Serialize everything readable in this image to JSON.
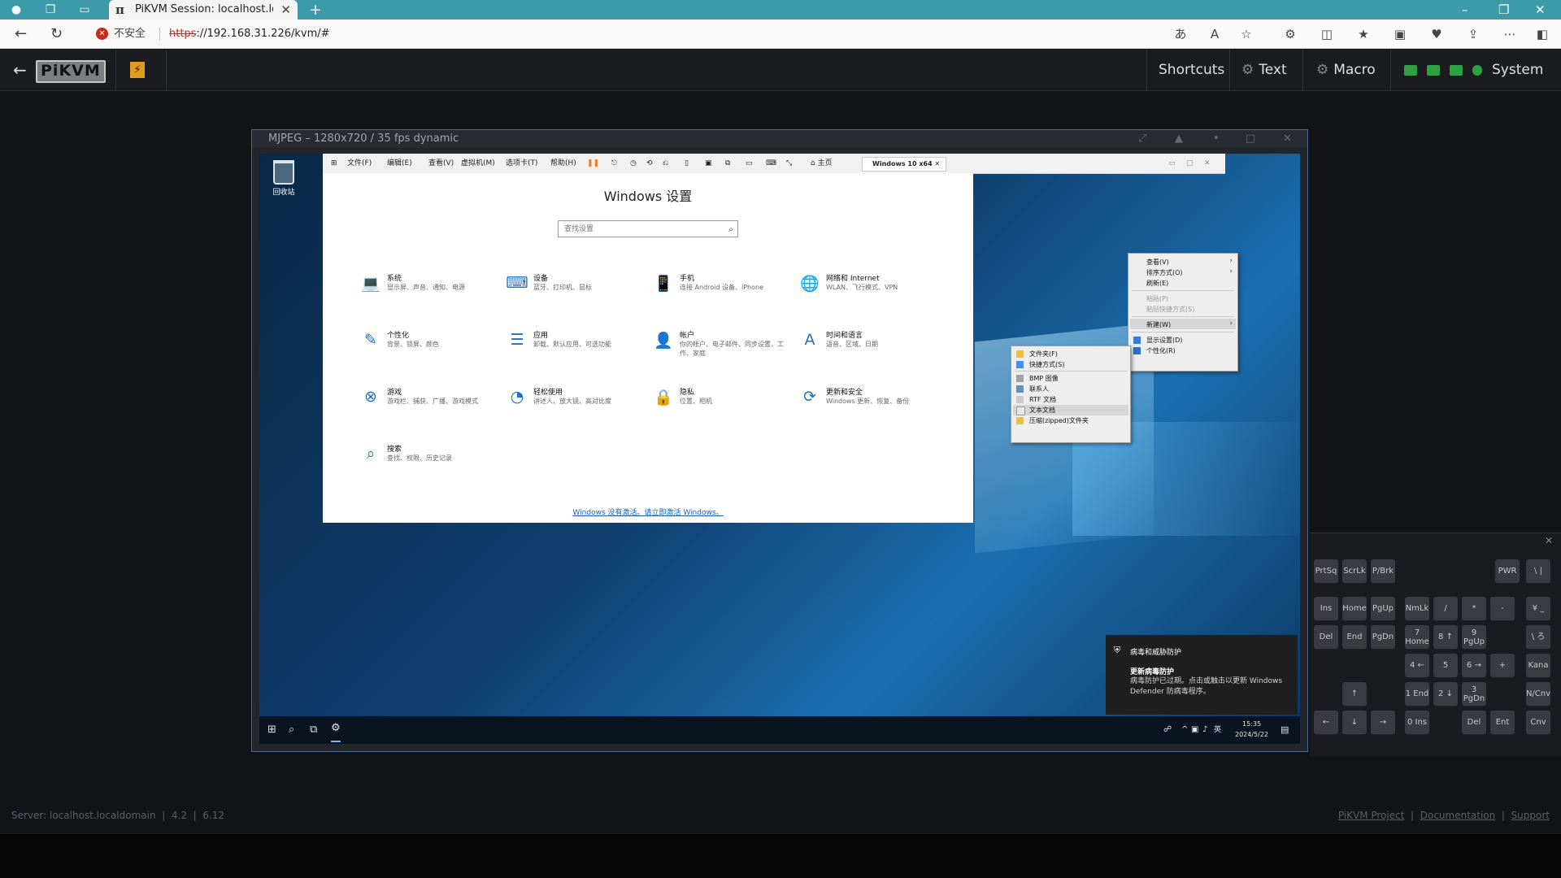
{
  "browser": {
    "tab_title": "PiKVM Session: localhost.localdo",
    "new_tab": "+",
    "security_label": "不安全",
    "url_scheme": "https",
    "url_rest": "://192.168.31.226/kvm/#"
  },
  "kvm_nav": {
    "logo": "PiKVM",
    "menus": [
      "Shortcuts",
      "Text",
      "Macro",
      "System"
    ],
    "led_colors": [
      "#2ea043",
      "#2ea043",
      "#2ea043",
      "#2ea043"
    ]
  },
  "stream": {
    "title": "MJPEG – 1280x720 / 35 fps dynamic"
  },
  "vm": {
    "recycle_bin": "回收站",
    "toolbar_menus": [
      "文件(F)",
      "编辑(E)",
      "查看(V)",
      "虚拟机(M)",
      "选项卡(T)",
      "帮助(H)"
    ],
    "tabs": [
      "主页",
      "Windows 10 x64"
    ],
    "settings": {
      "title": "Windows 设置",
      "search_placeholder": "查找设置",
      "items": [
        {
          "name": "系统",
          "desc": "显示屏、声音、通知、电源",
          "icon": "💻"
        },
        {
          "name": "设备",
          "desc": "蓝牙、打印机、鼠标",
          "icon": "⌨"
        },
        {
          "name": "手机",
          "desc": "连接 Android 设备、iPhone",
          "icon": "📱"
        },
        {
          "name": "网络和 Internet",
          "desc": "WLAN、飞行模式、VPN",
          "icon": "🌐"
        },
        {
          "name": "个性化",
          "desc": "背景、锁屏、颜色",
          "icon": "✎"
        },
        {
          "name": "应用",
          "desc": "卸载、默认应用、可选功能",
          "icon": "☰"
        },
        {
          "name": "帐户",
          "desc": "你的帐户、电子邮件、同步设置、工作、家庭",
          "icon": "👤"
        },
        {
          "name": "时间和语言",
          "desc": "语音、区域、日期",
          "icon": "A"
        },
        {
          "name": "游戏",
          "desc": "游戏栏、捕获、广播、游戏模式",
          "icon": "⊗"
        },
        {
          "name": "轻松使用",
          "desc": "讲述人、放大镜、高对比度",
          "icon": "◔"
        },
        {
          "name": "隐私",
          "desc": "位置、相机",
          "icon": "🔒"
        },
        {
          "name": "更新和安全",
          "desc": "Windows 更新、恢复、备份",
          "icon": "⟳"
        },
        {
          "name": "搜索",
          "desc": "查找、权限、历史记录",
          "icon": "⌕"
        }
      ],
      "activation_link": "Windows 没有激活。请立即激活 Windows。"
    },
    "context_menu": {
      "items": [
        {
          "label": "查看(V)",
          "arrow": true,
          "disabled": false
        },
        {
          "label": "排序方式(O)",
          "arrow": true,
          "disabled": false
        },
        {
          "label": "刷新(E)",
          "arrow": false,
          "disabled": false
        },
        {
          "label": "粘贴(P)",
          "arrow": false,
          "disabled": true
        },
        {
          "label": "粘贴快捷方式(S)",
          "arrow": false,
          "disabled": true
        },
        {
          "label": "新建(W)",
          "arrow": true,
          "disabled": false
        },
        {
          "label": "显示设置(D)",
          "arrow": false,
          "disabled": false
        },
        {
          "label": "个性化(R)",
          "arrow": false,
          "disabled": false
        }
      ]
    },
    "new_submenu": {
      "items": [
        "文件夹(F)",
        "快捷方式(S)",
        "BMP 图像",
        "联系人",
        "RTF 文档",
        "文本文档",
        "压缩(zipped)文件夹"
      ]
    },
    "notification": {
      "source": "病毒和威胁防护",
      "heading": "更新病毒防护",
      "body": "病毒防护已过期。点击或触击以更新 Windows Defender 防病毒程序。"
    },
    "clock": {
      "time": "15:35",
      "date": "2024/5/22"
    }
  },
  "keyboard": {
    "keys": [
      {
        "label": "PrtSq"
      },
      {
        "label": "ScrLk"
      },
      {
        "label": "P/Brk"
      },
      {
        "label": "PWR"
      },
      {
        "label": "\\ |"
      },
      {
        "label": "Ins"
      },
      {
        "label": "Home"
      },
      {
        "label": "PgUp"
      },
      {
        "label": "NmLk"
      },
      {
        "label": "/"
      },
      {
        "label": "*"
      },
      {
        "label": "-"
      },
      {
        "label": "¥ _"
      },
      {
        "label": "Del"
      },
      {
        "label": "End"
      },
      {
        "label": "PgDn"
      },
      {
        "label": "7 Home"
      },
      {
        "label": "8 ↑"
      },
      {
        "label": "9 PgUp"
      },
      {
        "label": "\\ ろ"
      },
      {
        "label": "4 ←"
      },
      {
        "label": "5"
      },
      {
        "label": "6 →"
      },
      {
        "label": "+"
      },
      {
        "label": "Kana"
      },
      {
        "label": "↑"
      },
      {
        "label": "1 End"
      },
      {
        "label": "2 ↓"
      },
      {
        "label": "3 PgDn"
      },
      {
        "label": "N/Cnv"
      },
      {
        "label": "←"
      },
      {
        "label": "↓"
      },
      {
        "label": "→"
      },
      {
        "label": "0 Ins"
      },
      {
        "label": "Del"
      },
      {
        "label": "Ent"
      },
      {
        "label": "Cnv"
      }
    ]
  },
  "footer": {
    "server": "Server: localhost.localdomain",
    "version": "4.2",
    "kernel": "6.12",
    "links": [
      "PiKVM Project",
      "Documentation",
      "Support"
    ]
  }
}
